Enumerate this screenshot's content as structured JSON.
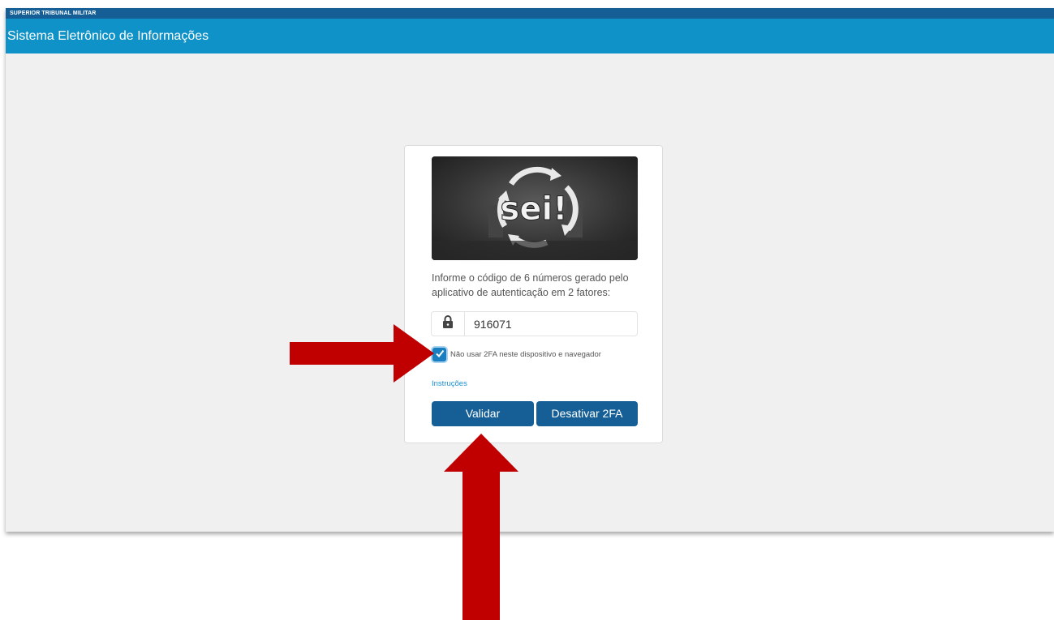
{
  "header": {
    "organization": "SUPERIOR TRIBUNAL MILITAR",
    "system_title": "Sistema Eletrônico de Informações"
  },
  "logo": {
    "text": "sei!"
  },
  "login": {
    "prompt": "Informe o código de 6 números gerado pelo aplicativo de autenticação em 2 fatores:",
    "code_value": "916071",
    "remember_label": "Não usar 2FA neste dispositivo e navegador",
    "remember_checked": true,
    "help_link": "Instruções",
    "validate_button": "Validar",
    "disable_button": "Desativar 2FA"
  },
  "icons": {
    "lock": "lock-icon",
    "check": "check-icon"
  },
  "colors": {
    "org_bar": "#155f96",
    "system_bar": "#0f92c7",
    "button": "#155f96",
    "checkbox": "#1a7fc1",
    "link": "#1a8fd0",
    "annotation_arrow": "#c00000"
  }
}
